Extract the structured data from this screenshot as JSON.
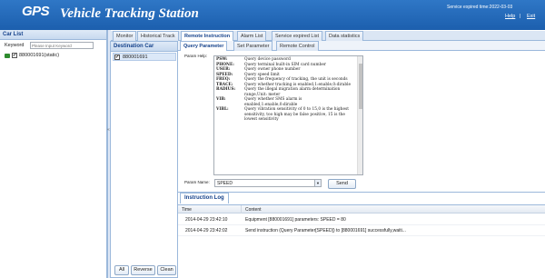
{
  "header": {
    "logo_gps": "GPS",
    "title": "Vehicle Tracking Station",
    "service_expired": "Service expired time:2022-03-03",
    "help_label": "Help",
    "exit_label": "Exit",
    "separator": "|"
  },
  "car_list": {
    "title": "Car List",
    "keyword_label": "Keyword",
    "keyword_placeholder": "Please Input Keyword",
    "items": [
      {
        "label": "880001691(static)",
        "checked": true
      }
    ]
  },
  "splitter_arrow": "«",
  "destination": {
    "title": "Destination Car",
    "items": [
      {
        "label": "880001691",
        "checked": true
      }
    ],
    "buttons": {
      "all": "All",
      "reverse": "Reverse",
      "clean": "Clean"
    }
  },
  "top_tabs": [
    "Monitor",
    "Historical Track",
    "Remote Instruction",
    "Alarm List",
    "Service expired List",
    "Data statistics"
  ],
  "sub_tabs": [
    "Query Parameter",
    "Set Parameter",
    "Remote Control"
  ],
  "param_help": {
    "label": "Param Help:",
    "rows": [
      {
        "key": "PSW:",
        "val": "Query device password"
      },
      {
        "key": "PHONE:",
        "val": "Query terminal built-in SIM card number"
      },
      {
        "key": "USER:",
        "val": "Query owner phone number"
      },
      {
        "key": "SPEED:",
        "val": "Query speed limit"
      },
      {
        "key": "FREQ:",
        "val": "Query the frequency of tracking, the unit is seconds"
      },
      {
        "key": "TRACE:",
        "val": "Query whether tracking is enabled,1:enable,0:dirable"
      },
      {
        "key": "RADIUS:",
        "val": "Query the illegal migration alarm determination range,Unit: meter"
      },
      {
        "key": "VIB:",
        "val": "Query whether SMS alarm is enabled,1:enable,0:dirable"
      },
      {
        "key": "VIBL:",
        "val": "Query vibration sensitivity of 0 to 15,0 is the highest sensitivity, too high may be false positive, 15 is the lowest sensitivity"
      }
    ]
  },
  "param_name": {
    "label": "Param Name:",
    "value": "SPEED",
    "arrow": "▼"
  },
  "send_label": "Send",
  "log": {
    "tab": "Instruction Log",
    "columns": [
      "Time",
      "Content"
    ],
    "rows": [
      {
        "time": "2014-04-29 23:42:10",
        "content": "Equipment [880001691] parameters: SPEED = 80"
      },
      {
        "time": "2014-04-29 23:42:02",
        "content": "Send instruction (Query Parameter[SPEED]) to [880001691] successfully,waiti..."
      }
    ]
  },
  "colors": {
    "header": "#1c5fae",
    "panel_title": "#15428b",
    "border": "#9bb8db"
  },
  "icons": {
    "car": "car-icon",
    "checkbox": "checkbox-icon"
  }
}
